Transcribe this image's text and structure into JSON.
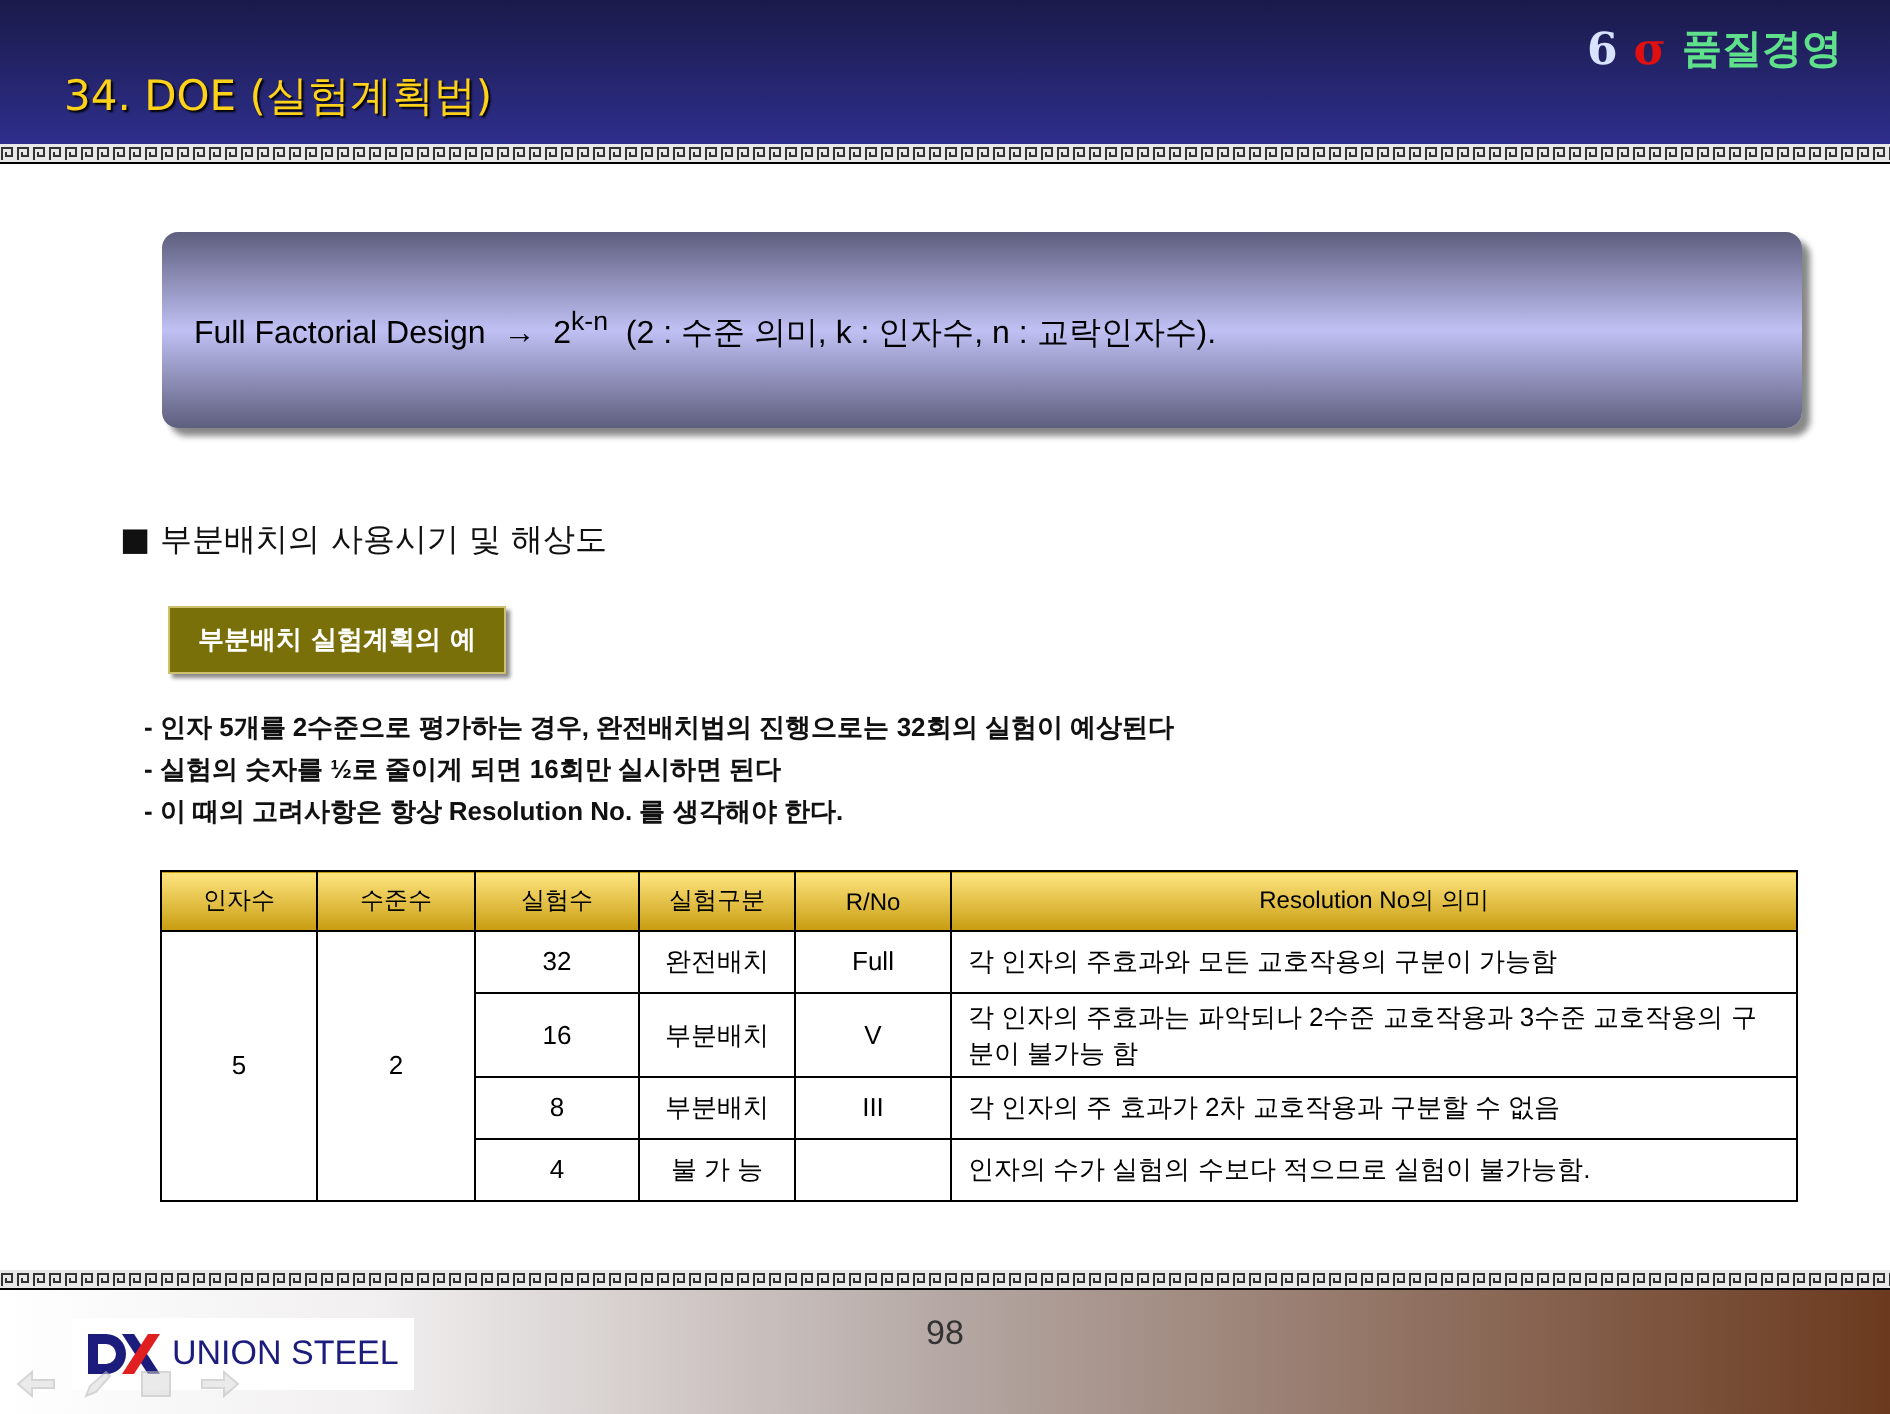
{
  "header": {
    "title": "34. DOE (실험계획법)",
    "brand_number": "6",
    "brand_sigma": "σ",
    "brand_text": "품질경영"
  },
  "formula_box": {
    "text": "Full Factorial Design  →  2$^{k-n}$  (2 : 수준 의미, k : 인자수, n : 교락인자수)."
  },
  "section_heading": "■ 부분배치의 사용시기 및 해상도",
  "example_label": "부분배치 실험계획의 예",
  "bullets": [
    "- 인자 **5**개를 **2**수준으로 평가하는 경우, 완전배치법의 진행으로는 **32**회의 실험이 예상된다",
    "- 실험의 숫자를 ½로 줄이게 되면 **16**회만 실시하면 된다",
    "- 이 때의 고려사항은 항상 **Resolution  No.** 를 생각해야 한다."
  ],
  "table": {
    "columns": [
      "인자수",
      "수준수",
      "실험수",
      "실험구분",
      "R/No",
      "Resolution No의 의미"
    ],
    "factors": "5",
    "levels": "2",
    "rows": [
      {
        "runs": "32",
        "design": "완전배치",
        "rno": "Full",
        "meaning": "각 인자의 주효과와 모든 교호작용의 구분이 가능함"
      },
      {
        "runs": "16",
        "design": "부분배치",
        "rno": "V",
        "meaning": "각 인자의 주효과는 파악되나 2수준 교호작용과 3수준 교호작용의 구분이 불가능 함"
      },
      {
        "runs": "8",
        "design": "부분배치",
        "rno": "III",
        "meaning": "각 인자의 주 효과가 2차 교호작용과 구분할 수 없음"
      },
      {
        "runs": "4",
        "design": "불 가 능",
        "meaning": "인자의 수가 실험의 수보다 적으므로 실험이 불가능함."
      }
    ]
  },
  "footer": {
    "logo_text": "UNION STEEL",
    "page_number": "98"
  }
}
